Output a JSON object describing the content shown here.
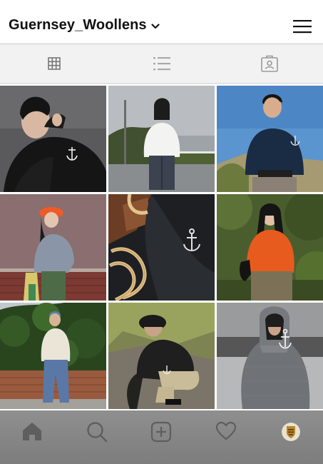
{
  "header": {
    "account_name": "Guernsey_Woollens",
    "chevron_icon": "chevron-down-icon",
    "menu_icon": "hamburger-menu-icon"
  },
  "profile_tabs": [
    {
      "icon": "grid-icon",
      "active": true
    },
    {
      "icon": "list-icon",
      "active": false
    },
    {
      "icon": "tagged-contact-icon",
      "active": false
    }
  ],
  "posts": [
    {
      "subject": "man in black sweater with white anchor, grey backdrop"
    },
    {
      "subject": "woman in white sweater on country road"
    },
    {
      "subject": "man in navy sweater with anchor, blue sky"
    },
    {
      "subject": "woman in orange cap and grey sweater by brick wall"
    },
    {
      "subject": "close-up of anchor sweater with rope and wooden crate"
    },
    {
      "subject": "woman in orange sweater among trees"
    },
    {
      "subject": "man in cream sweater and jeans by hedge"
    },
    {
      "subject": "man in cap crouching in black sweater"
    },
    {
      "subject": "man in grey hooded sweater with anchor"
    }
  ],
  "bottom_nav": [
    {
      "icon": "home-icon"
    },
    {
      "icon": "search-icon"
    },
    {
      "icon": "create-post-icon"
    },
    {
      "icon": "activity-heart-icon"
    },
    {
      "icon": "profile-avatar-icon"
    }
  ],
  "colors": {
    "header_bg": "#ffffff",
    "tabs_bg": "#f2f2f2",
    "bottom_nav_bg": "#8a8a8a",
    "icon_grey": "#8c8c8c",
    "text": "#111111"
  }
}
